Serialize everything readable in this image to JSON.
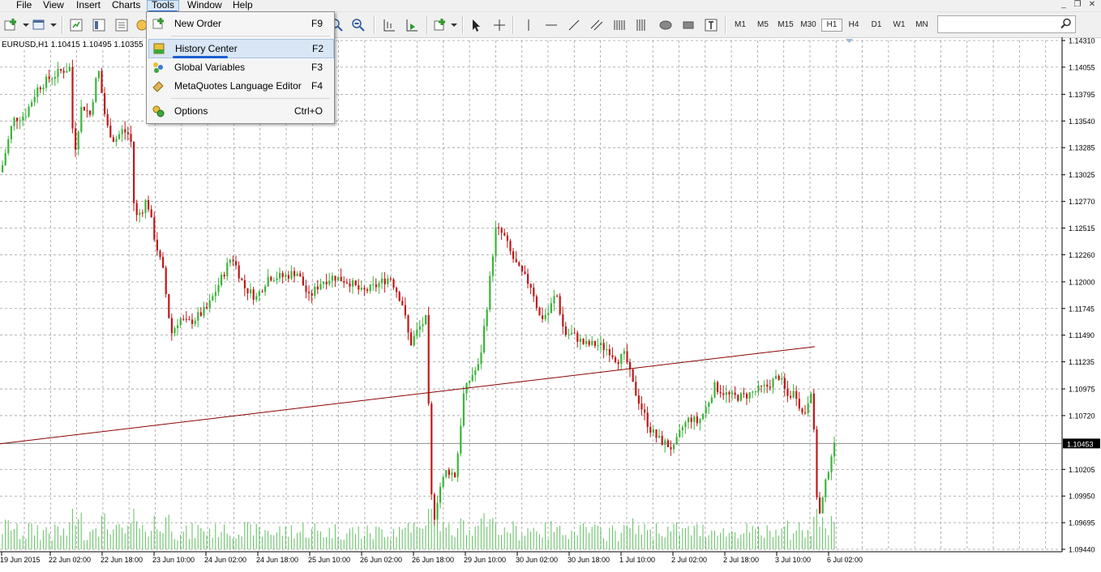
{
  "menubar": {
    "items": [
      "File",
      "View",
      "Insert",
      "Charts",
      "Tools",
      "Window",
      "Help"
    ]
  },
  "window_controls": {
    "minimize": "_",
    "restore": "❐",
    "close": "✕"
  },
  "timeframes": [
    "M1",
    "M5",
    "M15",
    "M30",
    "H1",
    "H4",
    "D1",
    "W1",
    "MN"
  ],
  "active_timeframe": "H1",
  "tools_menu": {
    "items": [
      {
        "label": "New Order",
        "shortcut": "F9",
        "icon": "new-order-icon"
      },
      {
        "label": "History Center",
        "shortcut": "F2",
        "icon": "history-center-icon"
      },
      {
        "label": "Global Variables",
        "shortcut": "F3",
        "icon": "global-variables-icon"
      },
      {
        "label": "MetaQuotes Language Editor",
        "shortcut": "F4",
        "icon": "metaeditor-icon"
      },
      {
        "label": "Options",
        "shortcut": "Ctrl+O",
        "icon": "options-icon"
      }
    ],
    "highlighted": "History Center"
  },
  "chart": {
    "symbol_info": "EURUSD,H1  1.10415 1.10495 1.10355",
    "current_price_label": "1.10453",
    "colors": {
      "bull": "#3cb43c",
      "bear": "#c01818",
      "volume": "#5fbf5f",
      "trendline": "#8b0000",
      "grid": "#9e9e9e"
    }
  },
  "chart_data": {
    "type": "candlestick",
    "symbol": "EURUSD",
    "timeframe": "H1",
    "price_ticks": [
      "1.14310",
      "1.14055",
      "1.13795",
      "1.13540",
      "1.13285",
      "1.13025",
      "1.12770",
      "1.12515",
      "1.12260",
      "1.12000",
      "1.11745",
      "1.11490",
      "1.11235",
      "1.10975",
      "1.10720",
      "1.10205",
      "1.09950",
      "1.09695",
      "1.09440"
    ],
    "time_ticks": [
      "19 Jun 2015",
      "22 Jun 02:00",
      "22 Jun 18:00",
      "23 Jun 10:00",
      "24 Jun 02:00",
      "24 Jun 18:00",
      "25 Jun 10:00",
      "26 Jun 02:00",
      "26 Jun 18:00",
      "29 Jun 10:00",
      "30 Jun 02:00",
      "30 Jun 18:00",
      "1 Jul 10:00",
      "2 Jul 02:00",
      "2 Jul 18:00",
      "3 Jul 10:00",
      "6 Jul 02:00"
    ],
    "ylim": [
      1.0944,
      1.1431
    ],
    "current_price": 1.10453,
    "ohlc_bar": {
      "open": 1.10415,
      "high": 1.10495,
      "low": 1.10355
    },
    "trendline": {
      "from_price": 1.1045,
      "to_price": 1.1138
    },
    "price_path": [
      [
        0,
        1.1305
      ],
      [
        15,
        1.1355
      ],
      [
        30,
        1.136
      ],
      [
        45,
        1.1385
      ],
      [
        60,
        1.1395
      ],
      [
        75,
        1.1402
      ],
      [
        85,
        1.1405
      ],
      [
        90,
        1.132
      ],
      [
        100,
        1.137
      ],
      [
        110,
        1.136
      ],
      [
        120,
        1.1405
      ],
      [
        130,
        1.135
      ],
      [
        140,
        1.1335
      ],
      [
        150,
        1.1345
      ],
      [
        160,
        1.134
      ],
      [
        165,
        1.126
      ],
      [
        175,
        1.127
      ],
      [
        180,
        1.128
      ],
      [
        190,
        1.124
      ],
      [
        200,
        1.121
      ],
      [
        210,
        1.115
      ],
      [
        220,
        1.1165
      ],
      [
        230,
        1.116
      ],
      [
        240,
        1.1165
      ],
      [
        255,
        1.1175
      ],
      [
        270,
        1.12
      ],
      [
        285,
        1.1225
      ],
      [
        300,
        1.1195
      ],
      [
        315,
        1.1185
      ],
      [
        330,
        1.1205
      ],
      [
        350,
        1.1205
      ],
      [
        365,
        1.121
      ],
      [
        380,
        1.1185
      ],
      [
        395,
        1.12
      ],
      [
        410,
        1.1205
      ],
      [
        430,
        1.12
      ],
      [
        445,
        1.119
      ],
      [
        460,
        1.1195
      ],
      [
        480,
        1.1205
      ],
      [
        495,
        1.118
      ],
      [
        505,
        1.114
      ],
      [
        515,
        1.1155
      ],
      [
        525,
        1.1165
      ],
      [
        530,
        1.1
      ],
      [
        535,
        1.0975
      ],
      [
        540,
        1.1
      ],
      [
        550,
        1.102
      ],
      [
        560,
        1.1015
      ],
      [
        565,
        1.1045
      ],
      [
        570,
        1.109
      ],
      [
        580,
        1.111
      ],
      [
        590,
        1.112
      ],
      [
        600,
        1.118
      ],
      [
        610,
        1.125
      ],
      [
        620,
        1.1245
      ],
      [
        630,
        1.1225
      ],
      [
        640,
        1.121
      ],
      [
        655,
        1.1195
      ],
      [
        665,
        1.1165
      ],
      [
        675,
        1.117
      ],
      [
        685,
        1.119
      ],
      [
        695,
        1.115
      ],
      [
        705,
        1.115
      ],
      [
        720,
        1.114
      ],
      [
        735,
        1.114
      ],
      [
        750,
        1.1135
      ],
      [
        760,
        1.1125
      ],
      [
        770,
        1.113
      ],
      [
        780,
        1.11
      ],
      [
        790,
        1.108
      ],
      [
        800,
        1.106
      ],
      [
        810,
        1.105
      ],
      [
        820,
        1.1045
      ],
      [
        830,
        1.104
      ],
      [
        840,
        1.106
      ],
      [
        850,
        1.107
      ],
      [
        860,
        1.1065
      ],
      [
        870,
        1.108
      ],
      [
        880,
        1.11
      ],
      [
        890,
        1.1095
      ],
      [
        900,
        1.109
      ],
      [
        915,
        1.109
      ],
      [
        930,
        1.1095
      ],
      [
        945,
        1.11
      ],
      [
        960,
        1.111
      ],
      [
        970,
        1.109
      ],
      [
        980,
        1.1095
      ],
      [
        990,
        1.107
      ],
      [
        1000,
        1.11
      ],
      [
        1008,
        1.097
      ],
      [
        1012,
        1.0985
      ],
      [
        1018,
        1.101
      ],
      [
        1024,
        1.1035
      ],
      [
        1030,
        1.1045
      ]
    ]
  }
}
